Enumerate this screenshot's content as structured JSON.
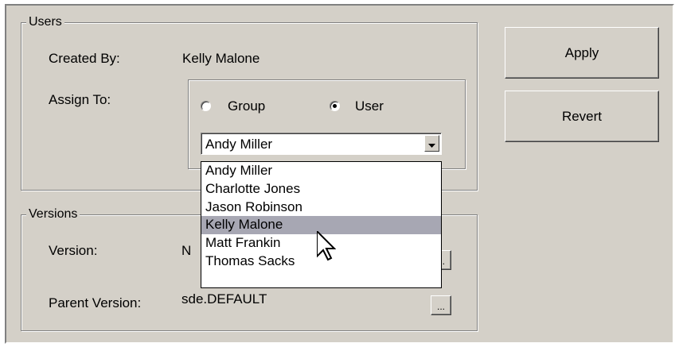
{
  "users": {
    "legend": "Users",
    "created_by_label": "Created By:",
    "created_by_value": "Kelly Malone",
    "assign_to_label": "Assign To:",
    "radio_group_label": "Group",
    "radio_user_label": "User",
    "selected_radio": "User",
    "combo_value": "Andy Miller",
    "dropdown_items": [
      "Andy Miller",
      "Charlotte Jones",
      "Jason Robinson",
      "Kelly Malone",
      "Matt Frankin",
      "Thomas Sacks"
    ],
    "highlighted_item": "Kelly Malone"
  },
  "versions": {
    "legend": "Versions",
    "version_label": "Version:",
    "version_value_partial": "N",
    "parent_version_label": "Parent Version:",
    "parent_version_value": "sde.DEFAULT",
    "browse_label": "..."
  },
  "buttons": {
    "apply": "Apply",
    "revert": "Revert"
  },
  "icons": {
    "dropdown_arrow": "chevron-down-icon",
    "cursor": "mouse-pointer-icon"
  },
  "colors": {
    "face": "#d4d0c8",
    "highlight": "#a7a7b3"
  }
}
